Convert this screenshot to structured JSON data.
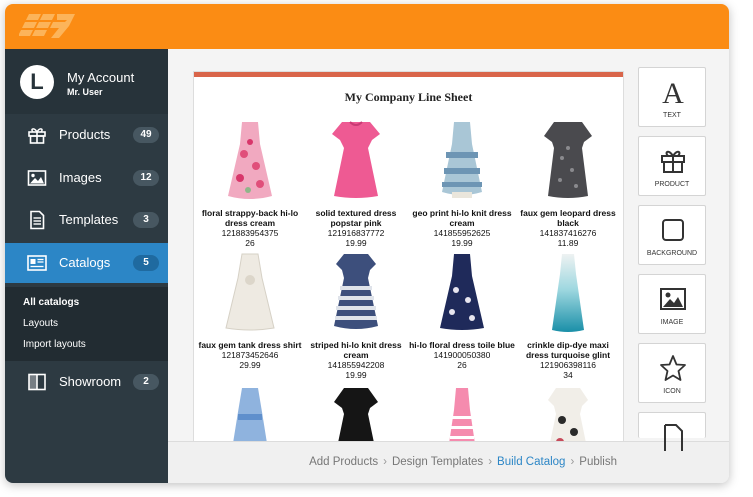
{
  "sidebar": {
    "account": {
      "initial": "L",
      "title": "My Account",
      "user": "Mr. User"
    },
    "items": [
      {
        "label": "Products",
        "count": "49",
        "icon": "gift-icon"
      },
      {
        "label": "Images",
        "count": "12",
        "icon": "image-icon"
      },
      {
        "label": "Templates",
        "count": "3",
        "icon": "document-icon"
      },
      {
        "label": "Catalogs",
        "count": "5",
        "icon": "catalog-icon",
        "active": true
      },
      {
        "label": "Showroom",
        "count": "2",
        "icon": "showroom-icon"
      }
    ],
    "subnav": [
      "All catalogs",
      "Layouts",
      "Import layouts"
    ]
  },
  "sheet": {
    "title": "My Company Line Sheet",
    "products": [
      {
        "name": "floral strappy-back hi-lo dress cream",
        "sku": "121883954375",
        "price": "26"
      },
      {
        "name": "solid textured dress popstar pink",
        "sku": "121916837772",
        "price": "19.99"
      },
      {
        "name": "geo print hi-lo knit dress cream",
        "sku": "141855952625",
        "price": "19.99"
      },
      {
        "name": "faux gem leopard dress black",
        "sku": "141837416276",
        "price": "11.89"
      },
      {
        "name": "faux gem tank dress shirt",
        "sku": "121873452646",
        "price": "29.99"
      },
      {
        "name": "striped hi-lo knit dress cream",
        "sku": "141855942208",
        "price": "19.99"
      },
      {
        "name": "hi-lo floral dress toile blue",
        "sku": "141900050380",
        "price": "26"
      },
      {
        "name": "crinkle dip-dye maxi dress turquoise glint",
        "sku": "121906398116",
        "price": "34"
      }
    ]
  },
  "tools": [
    {
      "label": "TEXT",
      "icon": "text-icon"
    },
    {
      "label": "PRODUCT",
      "icon": "gift-icon"
    },
    {
      "label": "BACKGROUND",
      "icon": "square-icon"
    },
    {
      "label": "IMAGE",
      "icon": "image-icon"
    },
    {
      "label": "ICON",
      "icon": "star-icon"
    },
    {
      "label": "",
      "icon": "file-icon"
    }
  ],
  "footer": {
    "steps": [
      "Add Products",
      "Design Templates",
      "Build Catalog",
      "Publish"
    ],
    "current": "Build Catalog"
  },
  "colors": {
    "topbar": "#fb8c14",
    "sidebar": "#2d3a42",
    "active": "#2c86c6",
    "sheet_accent": "#d9654a"
  }
}
